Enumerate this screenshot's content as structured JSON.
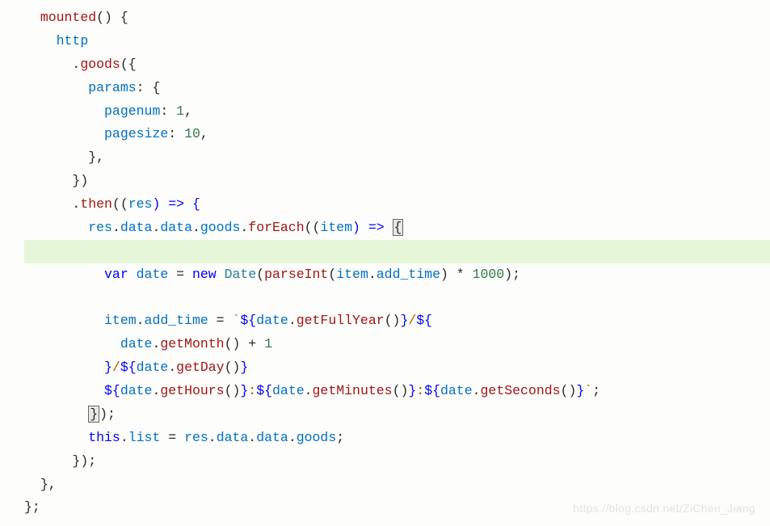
{
  "tokens": {
    "mounted": "mounted",
    "open_paren1": "()",
    "open_brace1": " {",
    "http": "http",
    "dot1": ".",
    "goods": "goods",
    "open_paren2": "({",
    "params": "params",
    "colon1": ": {",
    "pagenum": "pagenum",
    "colon2": ": ",
    "num1": "1",
    "comma1": ",",
    "pagesize": "pagesize",
    "colon3": ": ",
    "num10": "10",
    "comma2": ",",
    "close_brace_comma": "},",
    "close_paren_brace": "})",
    "dot2": ".",
    "then": "then",
    "open_paren3": "((",
    "res": "res",
    "arrow1": ") => {",
    "res2": "res",
    "dot3": ".",
    "data1": "data",
    "dot4": ".",
    "data2": "data",
    "dot5": ".",
    "goods2": "goods",
    "dot6": ".",
    "forEach": "forEach",
    "open_paren4": "((",
    "item": "item",
    "arrow2": ") => ",
    "cursor_brace": "{",
    "var": "var",
    "space1": " ",
    "date_var": "date",
    "equals1": " = ",
    "new": "new",
    "space2": " ",
    "Date": "Date",
    "open_paren5": "(",
    "parseInt": "parseInt",
    "open_paren6": "(",
    "item2": "item",
    "dot7": ".",
    "add_time": "add_time",
    "close_paren1": ") * ",
    "num1000": "1000",
    "close_paren2_semi": ");",
    "item3": "item",
    "dot8": ".",
    "add_time2": "add_time",
    "equals2": " = ",
    "backtick1": "`",
    "dollar1": "${",
    "date1": "date",
    "dot9": ".",
    "getFullYear": "getFullYear",
    "call1": "()",
    "close_dollar1": "}",
    "slash1": "/",
    "dollar2": "${",
    "date2": "date",
    "dot10": ".",
    "getMonth": "getMonth",
    "call2": "()",
    "plus1": " + ",
    "num_one": "1",
    "close_dollar2": "}",
    "slash2": "/",
    "dollar3": "${",
    "date3": "date",
    "dot11": ".",
    "getDay": "getDay",
    "call3": "()",
    "close_dollar3": "}",
    "dollar4": "${",
    "date4": "date",
    "dot12": ".",
    "getHours": "getHours",
    "call4": "()",
    "close_dollar4": "}",
    "colon_str1": ":",
    "dollar5": "${",
    "date5": "date",
    "dot13": ".",
    "getMinutes": "getMinutes",
    "call5": "()",
    "close_dollar5": "}",
    "colon_str2": ":",
    "dollar6": "${",
    "date6": "date",
    "dot14": ".",
    "getSeconds": "getSeconds",
    "call6": "()",
    "close_dollar6": "}",
    "backtick2": "`",
    "semi1": ";",
    "close_brace_paren_semi": "});",
    "cursor_close_brace": "}",
    "this": "this",
    "dot15": ".",
    "list": "list",
    "equals3": " = ",
    "res3": "res",
    "dot16": ".",
    "data3": "data",
    "dot17": ".",
    "data4": "data",
    "dot18": ".",
    "goods3": "goods",
    "semi2": ";",
    "close_paren_brace_semi": "});",
    "close_brace_comma2": "},",
    "close_brace_semi": "};"
  },
  "watermark": "https://blog.csdn.net/ZiChen_Jiang"
}
